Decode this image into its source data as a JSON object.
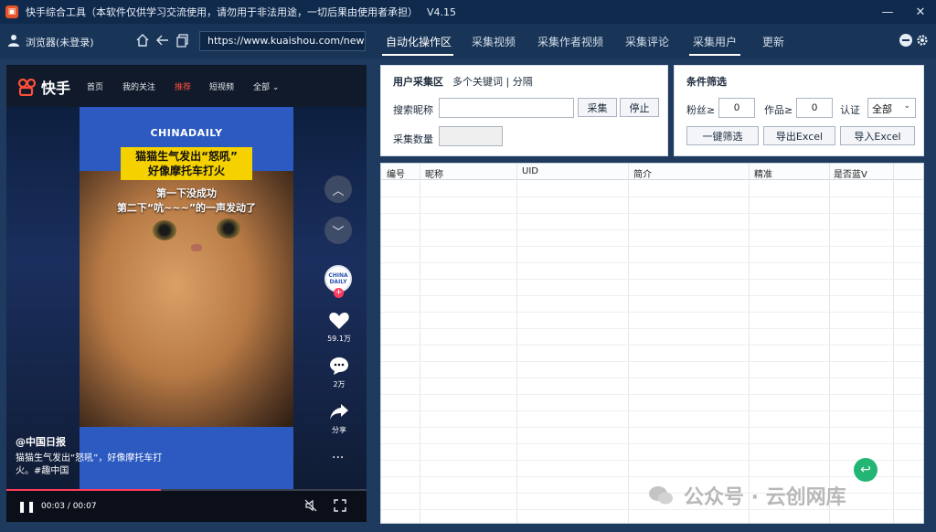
{
  "window": {
    "title": "快手综合工具（本软件仅供学习交流使用，请勿用于非法用途，一切后果由使用者承担）",
    "version": "V4.15",
    "controls": [
      "—",
      "✕"
    ]
  },
  "toolbar": {
    "browser_label": "浏览器(未登录)",
    "url": "https://www.kuaishou.com/new-r",
    "menu": [
      {
        "label": "自动化操作区",
        "active": true
      },
      {
        "label": "采集视频",
        "active": false
      },
      {
        "label": "采集作者视频",
        "active": false
      },
      {
        "label": "采集评论",
        "active": false
      },
      {
        "label": "采集用户",
        "active": false,
        "underlined": true
      },
      {
        "label": "更新",
        "active": false
      }
    ]
  },
  "browser": {
    "logo_text": "快手",
    "nav_tabs": [
      "首页",
      "我的关注",
      "推荐",
      "短视频",
      "全部 ⌄"
    ],
    "video": {
      "brand": "CHINADAILY",
      "headline_1": "猫猫生气发出“怒吼”",
      "headline_2": "好像摩托车打火",
      "subtitle_1": "第一下没成功",
      "subtitle_2": "第二下“吭~~~”的一声发动了"
    },
    "side": {
      "avatar_text": "CHINA DAILY",
      "likes": "59.1万",
      "comments": "2万",
      "share": "分享"
    },
    "author": "@中国日报",
    "description": "猫猫生气发出“怒吼”，好像摩托车打火。#趣中国",
    "time": "00:03 / 00:07",
    "progress": 0.43
  },
  "user_panel": {
    "title": "用户采集区",
    "tab": "多个关键词 | 分隔",
    "search_label": "搜索昵称",
    "search_value": "",
    "collect_button": "采集",
    "stop_button": "停止",
    "count_label": "采集数量",
    "count_value": ""
  },
  "filter_panel": {
    "title": "条件筛选",
    "fans_label": "粉丝≥",
    "fans_value": "0",
    "works_label": "作品≥",
    "works_value": "0",
    "verify_label": "认证",
    "verify_value": "全部",
    "filter_button": "一键筛选",
    "export_button": "导出Excel",
    "import_button": "导入Excel"
  },
  "table": {
    "columns": [
      "编号",
      "昵称",
      "UID",
      "简介",
      "精准",
      "是否蓝V"
    ]
  },
  "watermark": "公众号 · 云创网库",
  "colors": {
    "titlebar": "#0f2a4d",
    "toolbar": "#183457",
    "accent_red": "#ff3b5c",
    "chinadaily_blue": "#2d5ac0",
    "headline_yellow": "#f6d100"
  }
}
